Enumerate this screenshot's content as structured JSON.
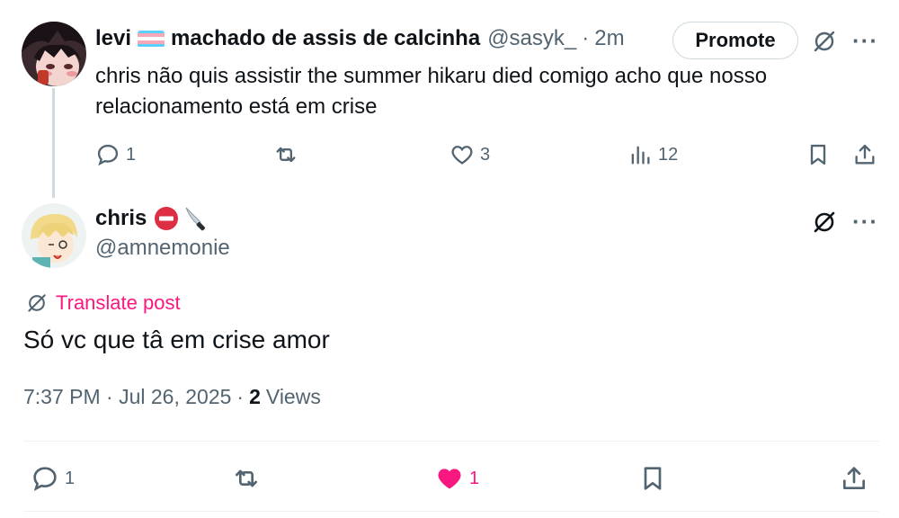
{
  "original_post": {
    "author_name": "levi",
    "author_name_suffix": "machado de assis de calcinha",
    "handle": "@sasyk_",
    "time_ago": "2m",
    "promote_label": "Promote",
    "text": "chris não quis assistir the summer hikaru died comigo acho que nosso relacionamento está em crise",
    "actions": {
      "replies": "1",
      "reposts": "",
      "likes": "3",
      "views": "12"
    }
  },
  "reply_post": {
    "author_name": "chris",
    "handle": "@amnemonie",
    "translate_label": "Translate post",
    "text": "Só vc que tâ em crise amor",
    "timestamp": "7:37 PM · Jul 26, 2025",
    "views_count": "2",
    "views_label": "Views",
    "actions": {
      "replies": "1",
      "reposts": "",
      "likes": "1",
      "liked": true
    }
  },
  "colors": {
    "accent_pink": "#f91880",
    "secondary_text": "#536471",
    "primary_text": "#0f1419",
    "border": "#cfd9de"
  },
  "icons": [
    "grok-icon",
    "more-icon",
    "reply-icon",
    "repost-icon",
    "like-icon",
    "views-icon",
    "bookmark-icon",
    "share-icon",
    "translate-icon",
    "no-entry-emoji",
    "knife-emoji",
    "trans-flag-emoji"
  ]
}
